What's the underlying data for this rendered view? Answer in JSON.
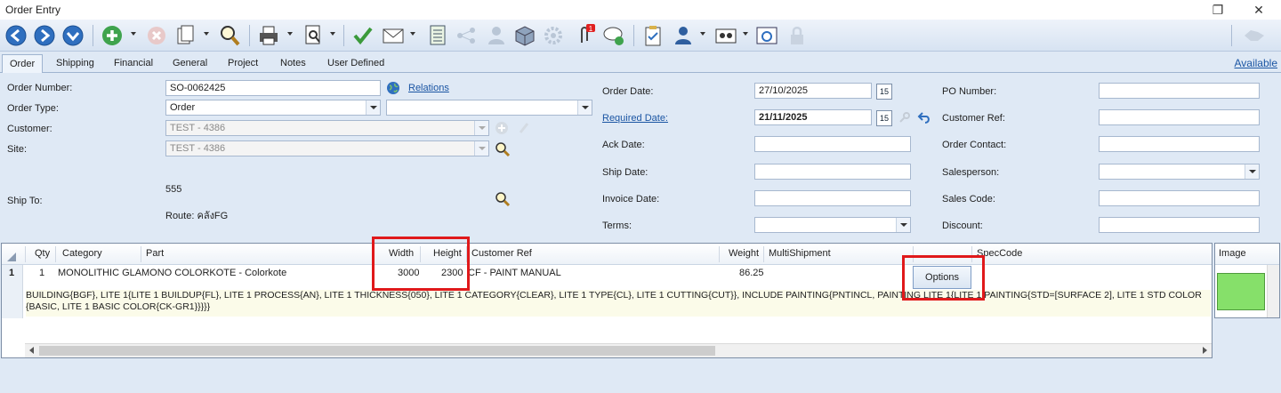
{
  "window": {
    "title": "Order Entry"
  },
  "tabs": [
    "Order",
    "Shipping",
    "Financial",
    "General",
    "Project",
    "Notes",
    "User Defined"
  ],
  "available_link": "Available",
  "left": {
    "order_number_label": "Order Number:",
    "order_number": "SO-0062425",
    "relations_link": "Relations",
    "order_type_label": "Order Type:",
    "order_type": "Order",
    "customer_label": "Customer:",
    "customer": "TEST - 4386",
    "site_label": "Site:",
    "site": "TEST - 4386",
    "ship_to_label": "Ship To:",
    "ship_to_value": "555",
    "route": "Route: คลังFG"
  },
  "middle": {
    "order_date_label": "Order Date:",
    "order_date": "27/10/2025",
    "required_date_label": "Required Date:",
    "required_date": "21/11/2025",
    "ack_date_label": "Ack Date:",
    "ship_date_label": "Ship Date:",
    "invoice_date_label": "Invoice Date:",
    "terms_label": "Terms:",
    "calendar_icon_text": "15"
  },
  "right": {
    "po_number_label": "PO Number:",
    "customer_ref_label": "Customer Ref:",
    "order_contact_label": "Order Contact:",
    "salesperson_label": "Salesperson:",
    "sales_code_label": "Sales Code:",
    "discount_label": "Discount:"
  },
  "grid": {
    "headers": {
      "qty": "Qty",
      "category": "Category",
      "part": "Part",
      "width": "Width",
      "height": "Height",
      "customer_ref": "Customer Ref",
      "weight": "Weight",
      "multishipment": "MultiShipment",
      "speccode": "SpecCode"
    },
    "row": {
      "line": "1",
      "qty": "1",
      "category": "MONOLITHIC GLASS",
      "part": "MONO COLORKOTE - Colorkote",
      "width": "3000",
      "height": "2300",
      "customer_ref": "CF - PAINT MANUAL",
      "weight": "86.25",
      "options_button": "Options"
    },
    "spec_line1": "BUILDING{BGF}, LITE 1{LITE 1 BUILDUP{FL}, LITE 1 PROCESS{AN}, LITE 1 THICKNESS{050}, LITE 1 CATEGORY{CLEAR}, LITE 1 TYPE{CL}, LITE 1 CUTTING{CUT}}, INCLUDE PAINTING{PNTINCL, PAINTING LITE 1{LITE 1 PAINTING{STD=[SURFACE 2], LITE 1 STD COLOR",
    "spec_line2": "{BASIC, LITE 1 BASIC COLOR{CK-GR1}}}}}"
  },
  "image_panel": {
    "header": "Image",
    "swatch_color": "#86e06a"
  },
  "colors": {
    "highlight": "#e0191b",
    "link": "#1a55a3",
    "background": "#dfe9f5"
  }
}
